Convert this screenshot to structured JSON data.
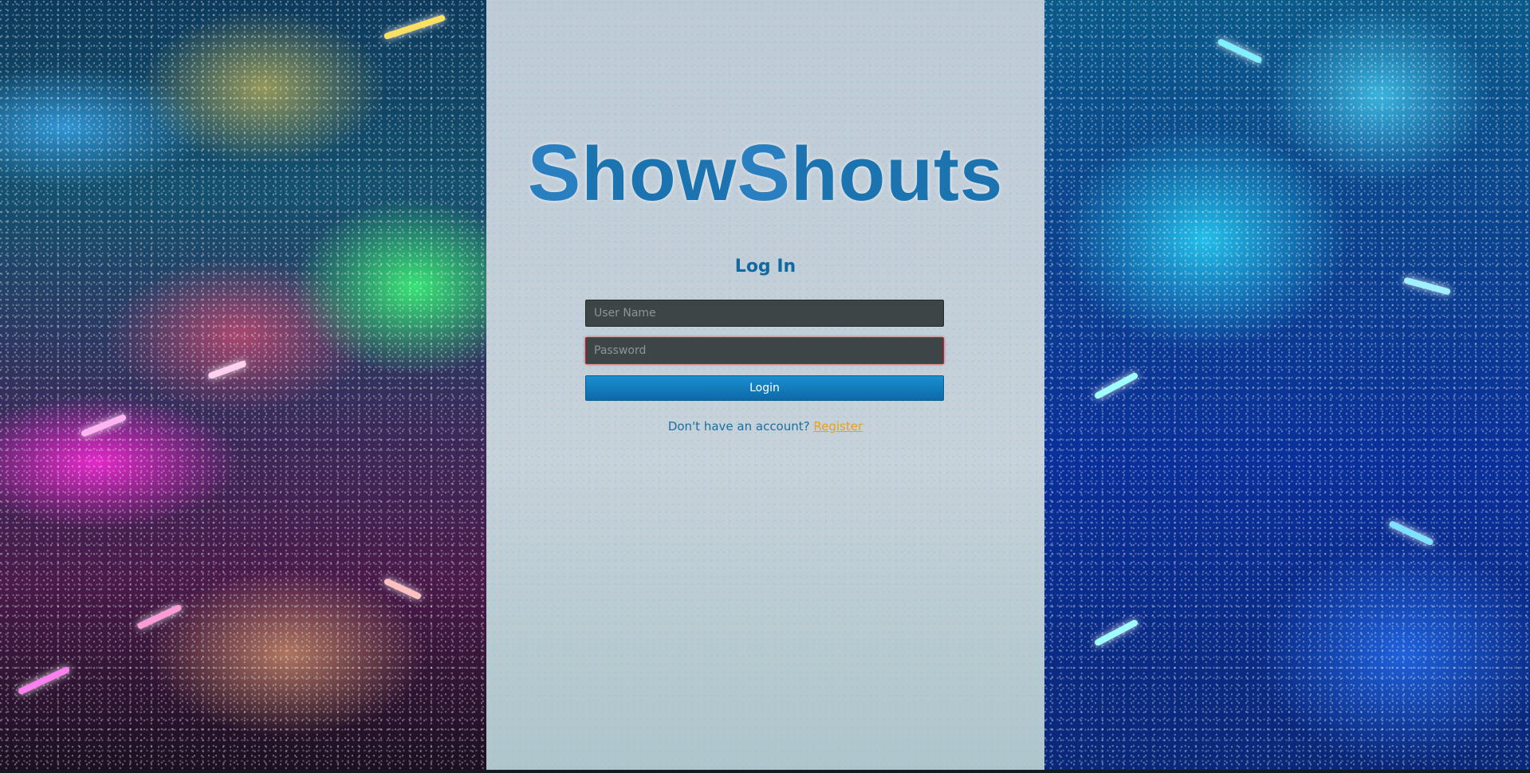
{
  "app": {
    "logo_text_part1": "S",
    "logo_text_part2": "how",
    "logo_text_part3": "S",
    "logo_text_part4": "houts"
  },
  "login": {
    "title": "Log In",
    "username_placeholder": "User Name",
    "password_placeholder": "Password",
    "submit_label": "Login",
    "no_account_text": "Don't have an account?",
    "register_link": "Register"
  },
  "colors": {
    "logo": "#1b73b0",
    "title": "#0e6aa0",
    "button": "#0b6aa8",
    "link": "#e8a020",
    "field_bg": "#3e4546",
    "error_border": "#c2202a"
  }
}
